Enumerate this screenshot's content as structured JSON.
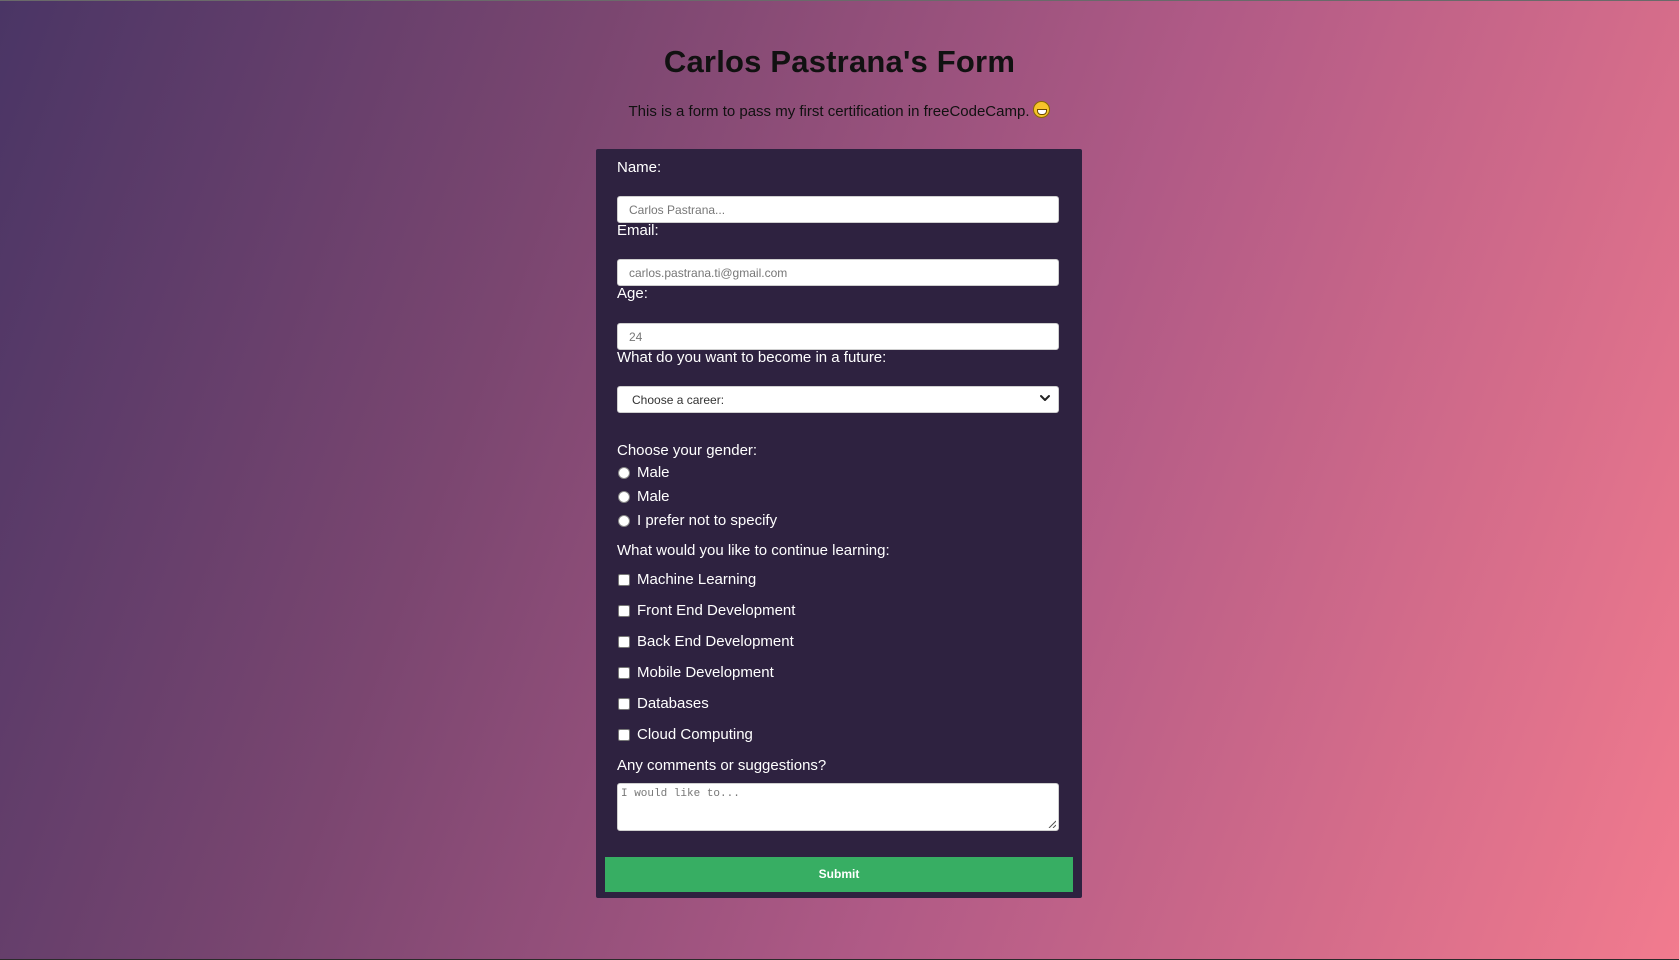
{
  "page": {
    "title": "Carlos Pastrana's Form",
    "description": "This is a form to pass my first certification in freeCodeCamp."
  },
  "form": {
    "name_label": "Name:",
    "name_placeholder": "Carlos Pastrana...",
    "email_label": "Email:",
    "email_placeholder": "carlos.pastrana.ti@gmail.com",
    "age_label": "Age:",
    "age_placeholder": "24",
    "career_label": "What do you want to become in a future:",
    "career_selected": "Choose a career:",
    "gender_label": "Choose your gender:",
    "gender_options": [
      "Male",
      "Male",
      "I prefer not to specify"
    ],
    "learning_label": "What would you like to continue learning:",
    "learning_options": [
      "Machine Learning",
      "Front End Development",
      "Back End Development",
      "Mobile Development",
      "Databases",
      "Cloud Computing"
    ],
    "comments_label": "Any comments or suggestions?",
    "comments_placeholder": "I would like to...",
    "submit_label": "Submit"
  },
  "colors": {
    "card_background": "#2e2240",
    "submit_background": "#37ae63",
    "gradient_start": "#4a3565",
    "gradient_end": "#f27b8e"
  },
  "icons": {
    "subtitle_emoji": "grinning-face-emoji-icon",
    "select_chevron": "chevron-down-icon"
  }
}
